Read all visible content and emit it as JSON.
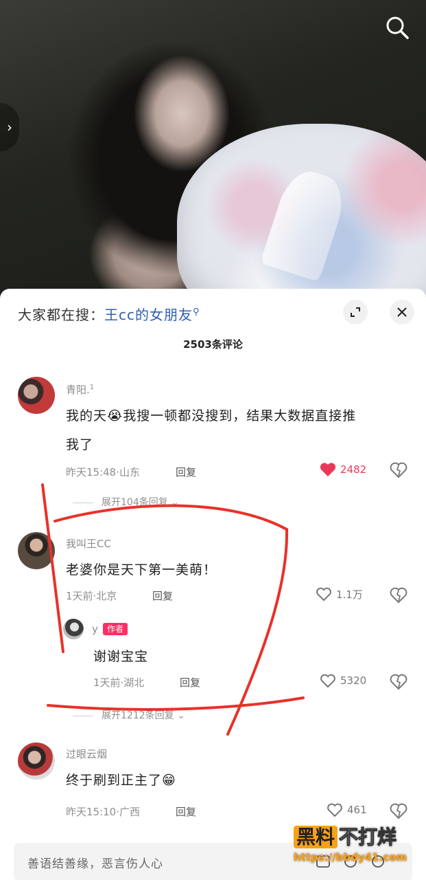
{
  "photo": {
    "search_icon": "search-icon",
    "side_arrow": "›"
  },
  "hot_search": {
    "label": "大家都在搜：",
    "keyword": "王cc的女朋友",
    "keyword_icon": "search-icon"
  },
  "header_buttons": {
    "expand_icon": "expand-icon",
    "close_icon": "close-icon"
  },
  "comment_count": "2503条评论",
  "comments": [
    {
      "user": "青阳.",
      "sup": "1",
      "text_line1": "我的天😭我搜一顿都没搜到，结果大数据直接推",
      "text_line2": "我了",
      "meta": "昨天15:48·山东",
      "reply": "回复",
      "likes": "2482",
      "liked": true,
      "expand": "展开104条回复"
    },
    {
      "user": "我叫王CC",
      "text": "老婆你是天下第一美萌！",
      "meta": "1天前·北京",
      "reply": "回复",
      "likes": "1.1万",
      "liked": false,
      "reply_item": {
        "user": "y",
        "tag": "作者",
        "text": "谢谢宝宝",
        "meta": "1天前·湖北",
        "reply": "回复",
        "likes": "5320"
      },
      "expand": "展开1212条回复"
    },
    {
      "user": "过眼云烟",
      "text": "终于刷到正主了😁",
      "meta": "昨天15:10·广西",
      "reply": "回复",
      "likes": "461",
      "liked": false
    }
  ],
  "input": {
    "placeholder": "善语结善缘，恶言伤人心"
  },
  "watermark": {
    "brand_a": "黑料",
    "brand_b": "不打烊",
    "url": "https://bbdy41.com"
  },
  "colors": {
    "like_active": "#e8395a",
    "link_blue": "#2d5fb0",
    "author_tag": "#ff2e63",
    "annotation_red": "#e8312a"
  }
}
